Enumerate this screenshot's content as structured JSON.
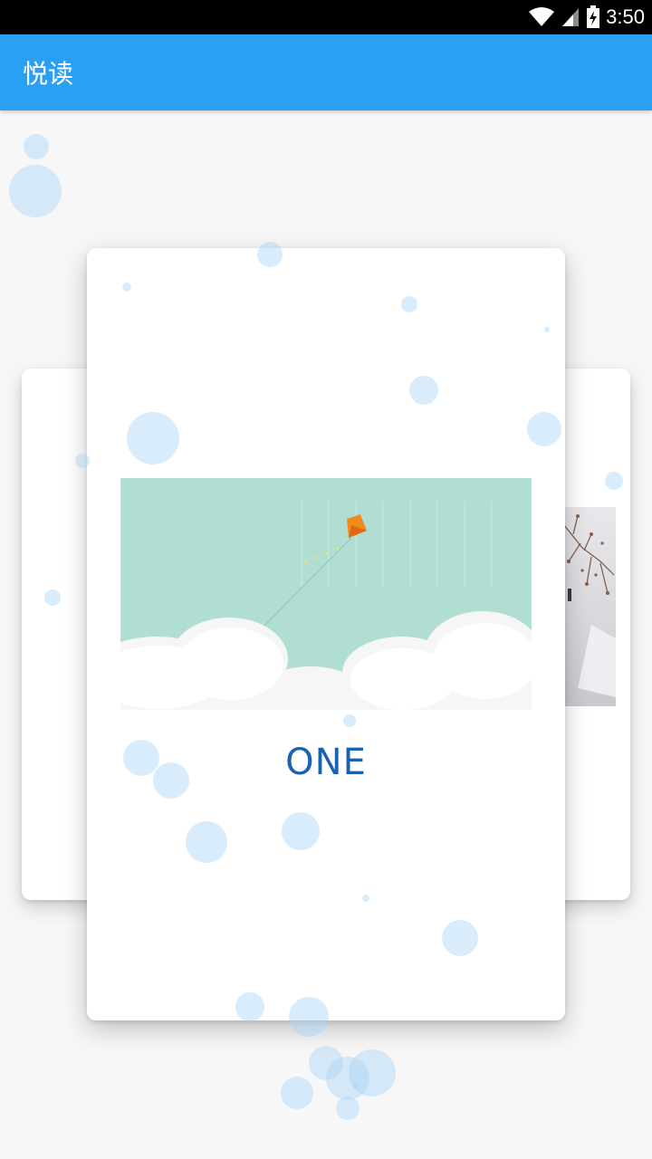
{
  "status_bar": {
    "time": "3:50"
  },
  "app_bar": {
    "title": "悦读"
  },
  "cards": {
    "center": {
      "title": "ONE"
    }
  },
  "icons": {
    "wifi": "wifi-icon",
    "signal": "signal-icon",
    "battery": "battery-charging-icon"
  },
  "colors": {
    "app_bar": "#2aa0f5",
    "title_text": "#1a62b0",
    "image_bg": "#b0ded3",
    "kite": "#f28a1e"
  }
}
